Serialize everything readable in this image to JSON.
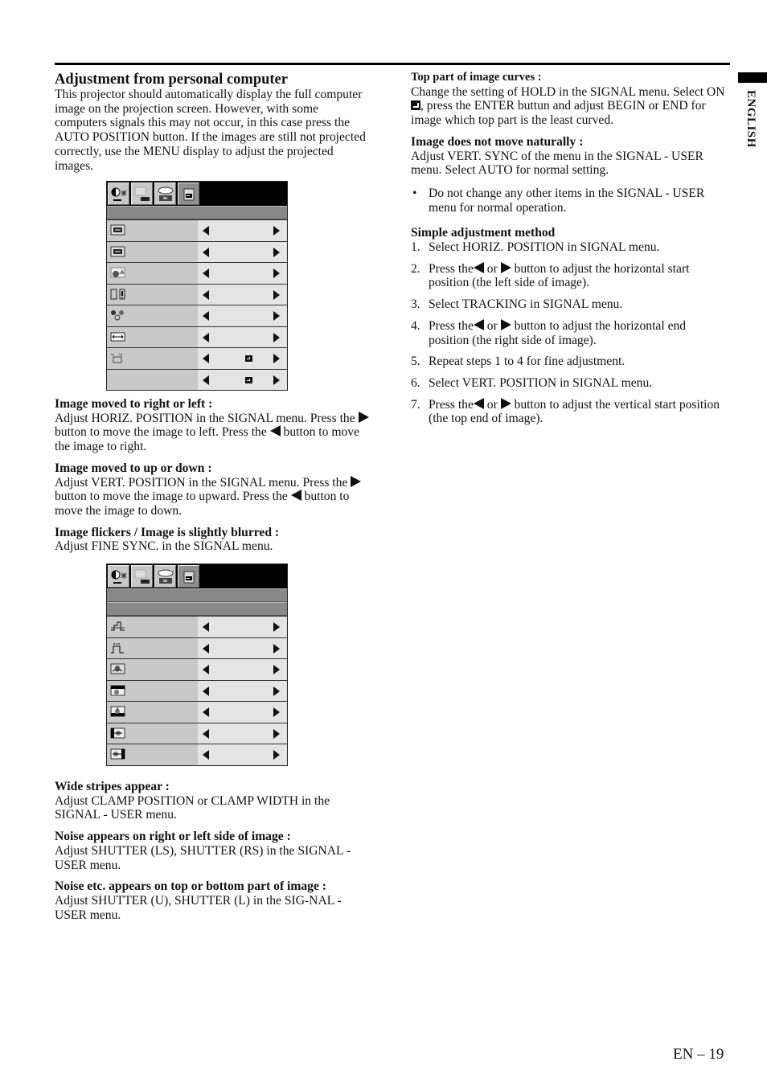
{
  "side_tab": {
    "label": "ENGLISH"
  },
  "page_number": "EN – 19",
  "left": {
    "section_title": "Adjustment from personal computer",
    "intro": "This projector should automatically display the full computer image on the projection screen. However, with some computers signals this may not occur, in this case press the AUTO POSITION button. If the images are still not projected correctly, use the MENU display to adjust the projected images.",
    "menu1": {
      "tabs": [
        "picture-tab-icon",
        "image-tab-icon",
        "installation-tab-icon",
        "signal-tab-icon"
      ],
      "active_tab": 3,
      "rows": [
        {
          "icon": "horiz-position-icon",
          "enter": false
        },
        {
          "icon": "vert-position-icon",
          "enter": false
        },
        {
          "icon": "fine-sync-icon",
          "enter": false
        },
        {
          "icon": "tracking-icon",
          "enter": false
        },
        {
          "icon": "rgb-dots-icon",
          "enter": false
        },
        {
          "icon": "width-icon",
          "enter": false
        },
        {
          "icon": "hold-icon",
          "enter": true
        },
        {
          "icon": "",
          "enter": true
        }
      ]
    },
    "topics1": [
      {
        "heading": "Image moved to right or left :",
        "lines": [
          {
            "pre": "Adjust HORIZ. POSITION in the SIGNAL menu. Press the ",
            "sym": "right",
            "post": " button to move the image to left.  Press the "
          },
          {
            "pre": "",
            "sym": "left",
            "post": " button to move the image to right."
          }
        ]
      },
      {
        "heading": "Image moved to up or down :",
        "lines": [
          {
            "pre": "Adjust VERT. POSITION in the SIGNAL menu. Press the ",
            "sym": "right",
            "post": " button to move the image to upward. Press the "
          },
          {
            "pre": "",
            "sym": "left",
            "post": " button to move the image to down."
          }
        ]
      },
      {
        "heading": "Image flickers / Image is slightly blurred :",
        "text": "Adjust FINE SYNC. in the SIGNAL menu."
      }
    ],
    "menu2": {
      "tabs": [
        "picture-tab-icon",
        "image-tab-icon",
        "installation-tab-icon",
        "signal-tab-icon"
      ],
      "active_tab": 3,
      "rows": [
        {
          "icon": "clamp-position-icon"
        },
        {
          "icon": "clamp-width-icon"
        },
        {
          "icon": "vert-sync-icon"
        },
        {
          "icon": "shutter-upper-icon"
        },
        {
          "icon": "shutter-lower-icon"
        },
        {
          "icon": "shutter-left-icon"
        },
        {
          "icon": "shutter-right-icon"
        }
      ]
    },
    "topics2": [
      {
        "heading": "Wide stripes appear :",
        "text": "Adjust CLAMP POSITION or CLAMP WIDTH in the SIGNAL - USER menu."
      },
      {
        "heading": "Noise appears on right or left side of image :",
        "text": "Adjust SHUTTER (LS), SHUTTER (RS) in the SIGNAL - USER menu."
      },
      {
        "heading": "Noise etc. appears on top or bottom part of image :",
        "text": "Adjust SHUTTER (U), SHUTTER (L) in the SIG-NAL - USER menu."
      }
    ]
  },
  "right": {
    "top_curves": {
      "heading": "Top part of image curves :",
      "text_a": "Change the setting of HOLD in the SIGNAL menu. Select ON",
      "text_b": ",  press the ENTER buttun and adjust BEGIN or END for image which top part is the least curved."
    },
    "not_natural": {
      "heading": "Image does not move naturally :",
      "text": "Adjust VERT. SYNC of the menu in the SIGNAL - USER menu.  Select AUTO for normal setting."
    },
    "bullet": "Do not change any other items in the SIGNAL - USER menu for normal operation.",
    "simple": {
      "heading": "Simple adjustment method",
      "steps": [
        {
          "num": "1.",
          "text": "Select HORIZ. POSITION in SIGNAL menu."
        },
        {
          "num": "2.",
          "pre": "Press the",
          "mid": " or ",
          "post": " button to adjust the horizontal start position (the left side of image)."
        },
        {
          "num": "3.",
          "text": "Select TRACKING in SIGNAL menu."
        },
        {
          "num": "4.",
          "pre": "Press the",
          "mid": " or ",
          "post": " button to adjust the horizontal end position (the right side of image)."
        },
        {
          "num": "5.",
          "text": "Repeat steps 1 to 4 for fine adjustment."
        },
        {
          "num": "6.",
          "text": "Select VERT. POSITION in SIGNAL menu."
        },
        {
          "num": "7.",
          "pre": "Press the",
          "mid": " or ",
          "post": " button to adjust the vertical start position (the top end of image)."
        }
      ]
    }
  }
}
